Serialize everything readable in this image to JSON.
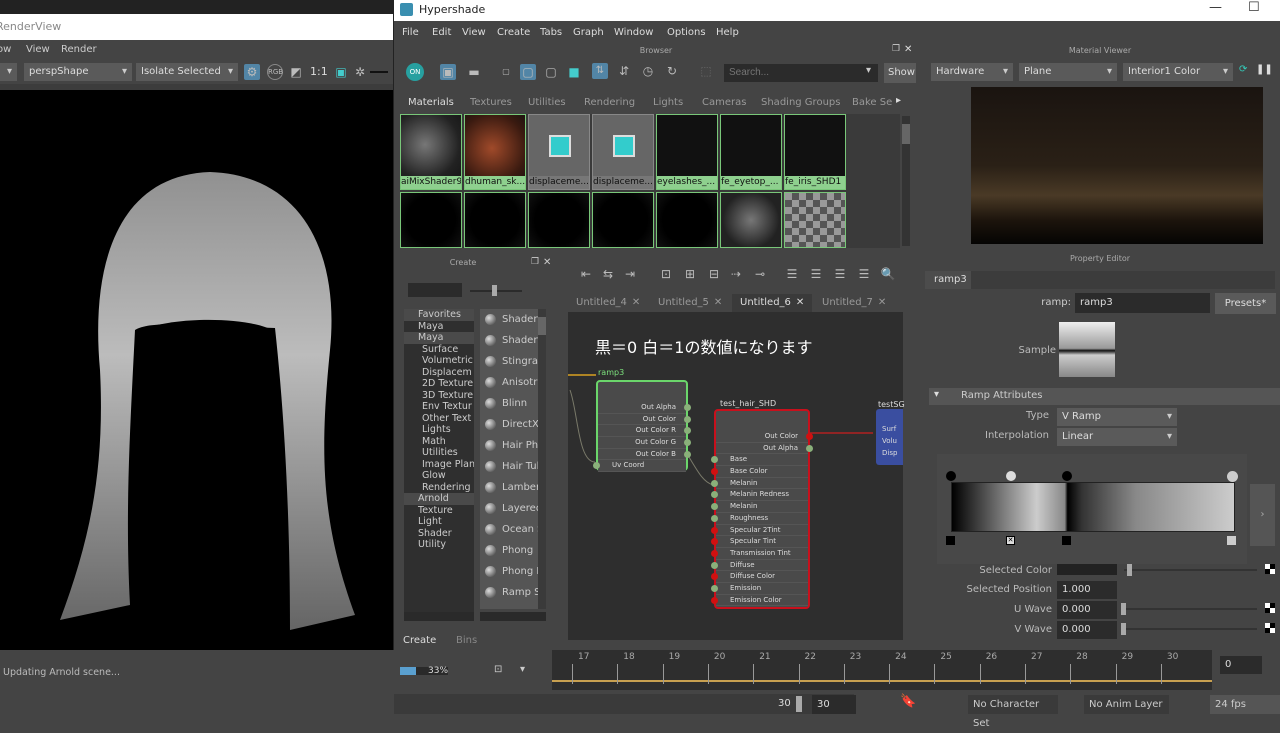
{
  "renderview": {
    "title": "RenderView",
    "menu": [
      "ow",
      "View",
      "Render"
    ],
    "camera": "perspShape",
    "isolate": "Isolate Selected",
    "ratio": "1:1",
    "status": "Updating Arnold scene..."
  },
  "hypershade": {
    "title": "Hypershade",
    "menu": [
      "File",
      "Edit",
      "View",
      "Create",
      "Tabs",
      "Graph",
      "Window",
      "Options",
      "Help"
    ],
    "browser": {
      "title": "Browser",
      "search_placeholder": "Search...",
      "show_label": "Show",
      "on_label": "ON",
      "tabs": [
        "Materials",
        "Textures",
        "Utilities",
        "Rendering",
        "Lights",
        "Cameras",
        "Shading Groups",
        "Bake Se"
      ],
      "materials": [
        "aiMixShader9",
        "dhuman_sk...",
        "displaceme...",
        "displaceme...",
        "eyelashes_...",
        "fe_eyetop_...",
        "fe_iris_SHD1"
      ]
    },
    "create": {
      "title": "Create",
      "tree": [
        "Favorites",
        "Maya",
        "Maya",
        "Surface",
        "Volumetric",
        "Displacem",
        "2D Texture",
        "3D Texture",
        "Env Textur",
        "Other Text",
        "Lights",
        "Math",
        "Utilities",
        "Image Plan",
        "Glow",
        "Rendering",
        "Arnold",
        "Texture",
        "Light",
        "Shader",
        "Utility"
      ],
      "items": [
        "Shaderf",
        "Shaderf",
        "Stingray",
        "Anisotr",
        "Blinn",
        "DirectX",
        "Hair Phy",
        "Hair Tul",
        "Lambert",
        "Layered",
        "Ocean S",
        "Phong",
        "Phong E",
        "Ramp S"
      ],
      "bottom_tabs": [
        "Create",
        "Bins"
      ]
    },
    "node_editor": {
      "tabs": [
        "Untitled_4",
        "Untitled_5",
        "Untitled_6",
        "Untitled_7"
      ],
      "annotation": "黒＝0 白＝1の数値になります",
      "ramp_node": {
        "name": "ramp3",
        "ports": [
          "Out Alpha",
          "Out Color",
          "Out Color R",
          "Out Color G",
          "Out Color B",
          "Uv Coord"
        ]
      },
      "hair_node": {
        "name": "test_hair_SHD",
        "ports": [
          "Out Color",
          "Out Alpha",
          "Base",
          "Base Color",
          "Melanin",
          "Melanin Redness",
          "Melanin Randomize",
          "Roughness",
          "Specular 2Tint",
          "Specular Tint",
          "Transmission Tint",
          "Diffuse",
          "Diffuse Color",
          "Emission",
          "Emission Color"
        ]
      },
      "sg_node": {
        "name": "testSG",
        "ports": [
          "Surf",
          "Volu",
          "Disp"
        ]
      }
    },
    "material_viewer": {
      "title": "Material Viewer",
      "renderer": "Hardware",
      "geometry": "Plane",
      "env": "Interior1 Color"
    },
    "property_editor": {
      "title": "Property Editor",
      "tab": "ramp3",
      "ramp_label": "ramp:",
      "ramp_value": "ramp3",
      "presets": "Presets*",
      "sample_label": "Sample",
      "section": "Ramp Attributes",
      "type_label": "Type",
      "type_value": "V Ramp",
      "interp_label": "Interpolation",
      "interp_value": "Linear",
      "selected_color_label": "Selected Color",
      "selected_position_label": "Selected Position",
      "selected_position": "1.000",
      "u_wave_label": "U Wave",
      "u_wave": "0.000",
      "v_wave_label": "V Wave",
      "v_wave": "0.000"
    }
  },
  "progress": {
    "percent": 33,
    "label": "33%"
  },
  "timeline": {
    "ticks": [
      "17",
      "18",
      "19",
      "20",
      "21",
      "22",
      "23",
      "24",
      "25",
      "26",
      "27",
      "28",
      "29",
      "30"
    ],
    "current": "0",
    "end1": "30",
    "end2": "30",
    "character_set": "No Character Set",
    "anim_layer": "No Anim Layer",
    "fps": "24 fps"
  }
}
